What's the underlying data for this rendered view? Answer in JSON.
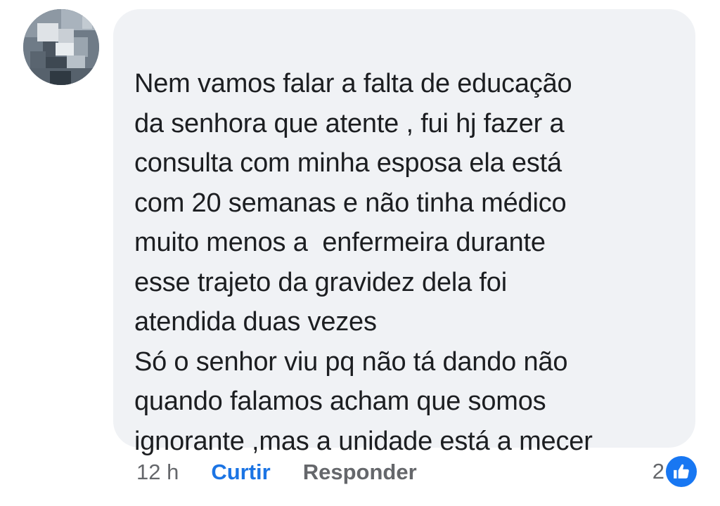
{
  "comment": {
    "lines": [
      "Nem vamos falar a falta de educação",
      "da senhora que atente , fui hj fazer a",
      "consulta com minha esposa ela está",
      "com 20 semanas e não tinha médico",
      "muito menos a  enfermeira durante",
      "esse trajeto da gravidez dela foi",
      "atendida duas vezes",
      "Só o senhor viu pq não tá dando não",
      "quando falamos acham que somos",
      "ignorante ,mas a unidade está a mecer"
    ]
  },
  "actions": {
    "timestamp": "12 h",
    "like_label": "Curtir",
    "reply_label": "Responder"
  },
  "reactions": {
    "count": "2",
    "icon": "thumbs-up-icon",
    "badge_color": "#1877f2"
  },
  "colors": {
    "bubble_bg": "#f0f2f5",
    "text": "#1c1e21",
    "muted": "#65676b",
    "link": "#1b74e4"
  }
}
